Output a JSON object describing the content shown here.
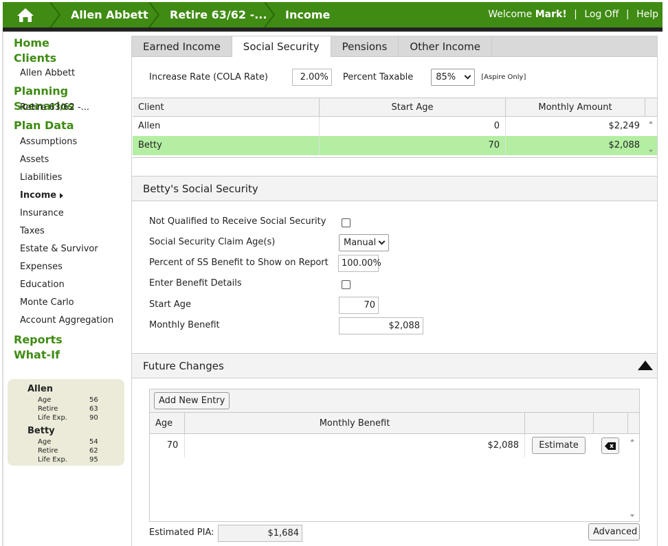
{
  "topbar": {
    "crumbs": [
      "Allen Abbett",
      "Retire 63/62 -...",
      "Income"
    ],
    "welcome_prefix": "Welcome",
    "user": "Mark!",
    "logoff": "Log Off",
    "help": "Help",
    "color": "#3f8b13"
  },
  "sidebar": {
    "home": "Home",
    "clients": "Clients",
    "client_name": "Allen Abbett",
    "planning": "Planning Scenarios",
    "scenario": "Retire 63/62 -...",
    "plan_data": "Plan Data",
    "items": [
      "Assumptions",
      "Assets",
      "Liabilities",
      "Income",
      "Insurance",
      "Taxes",
      "Estate & Survivor",
      "Expenses",
      "Education",
      "Monte Carlo",
      "Account Aggregation"
    ],
    "reports": "Reports",
    "whatif": "What-If"
  },
  "summary": {
    "people": [
      {
        "name": "Allen",
        "age_label": "Age",
        "age": "56",
        "retire_label": "Retire",
        "retire": "63",
        "life_label": "Life Exp.",
        "life": "90"
      },
      {
        "name": "Betty",
        "age_label": "Age",
        "age": "54",
        "retire_label": "Retire",
        "retire": "62",
        "life_label": "Life Exp.",
        "life": "95"
      }
    ]
  },
  "tabs": [
    "Earned Income",
    "Social Security",
    "Pensions",
    "Other Income"
  ],
  "rates": {
    "cola_label": "Increase Rate (COLA Rate)",
    "cola_value": "2.00%",
    "taxable_label": "Percent Taxable",
    "taxable_value": "85%",
    "aspire_note": "[Aspire Only]"
  },
  "client_grid": {
    "headers": [
      "Client",
      "Start Age",
      "Monthly Amount"
    ],
    "rows": [
      {
        "client": "Allen",
        "start_age": "0",
        "amount": "$2,249"
      },
      {
        "client": "Betty",
        "start_age": "70",
        "amount": "$2,088"
      }
    ]
  },
  "detail": {
    "title": "Betty's Social Security",
    "not_qualified_label": "Not Qualified to Receive Social Security",
    "claim_age_label": "Social Security Claim Age(s)",
    "claim_age_value": "Manual",
    "percent_label": "Percent of SS Benefit to Show on Report",
    "percent_value": "100.00%",
    "details_label": "Enter Benefit Details",
    "start_age_label": "Start Age",
    "start_age_value": "70",
    "monthly_label": "Monthly Benefit",
    "monthly_value": "$2,088"
  },
  "future": {
    "title": "Future Changes",
    "add_label": "Add New Entry",
    "headers": [
      "Age",
      "Monthly Benefit"
    ],
    "rows": [
      {
        "age": "70",
        "benefit": "$2,088",
        "estimate": "Estimate"
      }
    ],
    "pia_label": "Estimated PIA:",
    "pia_value": "$1,684",
    "advanced": "Advanced"
  }
}
